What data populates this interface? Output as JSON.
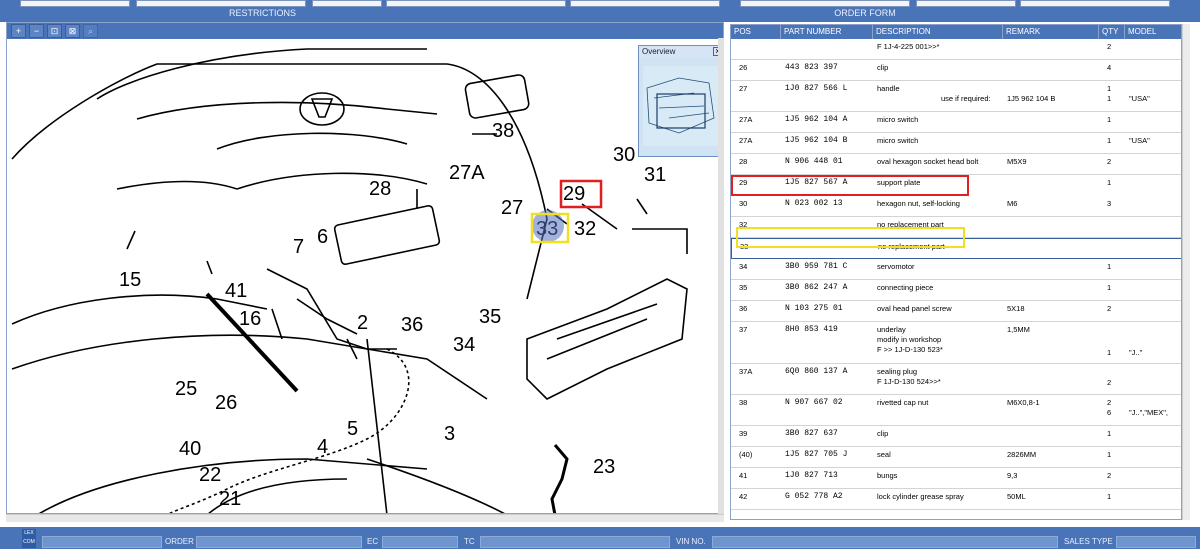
{
  "header": {
    "restrictions_label": "RESTRICTIONS",
    "order_form_label": "ORDER FORM"
  },
  "overview": {
    "title": "Overview",
    "close": "x"
  },
  "zoom_buttons": [
    "+",
    "−",
    "⊡",
    "⊠",
    "⌕"
  ],
  "callouts": [
    {
      "id": "c38",
      "text": "38"
    },
    {
      "id": "c28",
      "text": "28"
    },
    {
      "id": "c27a",
      "text": "27A"
    },
    {
      "id": "c27",
      "text": "27"
    },
    {
      "id": "c29",
      "text": "29"
    },
    {
      "id": "c30",
      "text": "30"
    },
    {
      "id": "c31",
      "text": "31"
    },
    {
      "id": "c33",
      "text": "33"
    },
    {
      "id": "c32",
      "text": "32"
    },
    {
      "id": "c15",
      "text": "15"
    },
    {
      "id": "c7",
      "text": "7"
    },
    {
      "id": "c6",
      "text": "6"
    },
    {
      "id": "c41",
      "text": "41"
    },
    {
      "id": "c16",
      "text": "16"
    },
    {
      "id": "c36",
      "text": "36"
    },
    {
      "id": "c35",
      "text": "35"
    },
    {
      "id": "c34",
      "text": "34"
    },
    {
      "id": "c2",
      "text": "2"
    },
    {
      "id": "c25",
      "text": "25"
    },
    {
      "id": "c26",
      "text": "26"
    },
    {
      "id": "c5",
      "text": "5"
    },
    {
      "id": "c4",
      "text": "4"
    },
    {
      "id": "c3",
      "text": "3"
    },
    {
      "id": "c40",
      "text": "40"
    },
    {
      "id": "c22",
      "text": "22"
    },
    {
      "id": "c21",
      "text": "21"
    },
    {
      "id": "c23",
      "text": "23"
    }
  ],
  "table": {
    "columns": [
      "POS",
      "PART NUMBER",
      "DESCRIPTION",
      "REMARK",
      "QTY",
      "MODEL"
    ],
    "rows": [
      {
        "pos": "",
        "part": "",
        "desc": "F 1J-4-225 001>>*",
        "remark": "",
        "qty": "2",
        "model": ""
      },
      {
        "pos": "26",
        "part": "443 823 397",
        "desc": "clip",
        "remark": "",
        "qty": "4",
        "model": ""
      },
      {
        "pos": "27",
        "part": "1J0 827 566 L",
        "desc": "handle",
        "remark": "",
        "qty": "1",
        "model": "",
        "sub": "use if required:",
        "sub_remark": "1J5 962 104 B",
        "sub_qty": "1",
        "sub_model": "\"USA\""
      },
      {
        "pos": "27A",
        "part": "1J5 962 104 A",
        "desc": "micro switch",
        "remark": "",
        "qty": "1",
        "model": ""
      },
      {
        "pos": "27A",
        "part": "1J5 962 104 B",
        "desc": "micro switch",
        "remark": "",
        "qty": "1",
        "model": "\"USA\""
      },
      {
        "pos": "28",
        "part": "N   906 448 01",
        "desc": "oval hexagon socket head bolt",
        "remark": "M5X9",
        "qty": "2",
        "model": ""
      },
      {
        "pos": "29",
        "part": "1J5 827 567 A",
        "desc": "support plate",
        "remark": "",
        "qty": "1",
        "model": ""
      },
      {
        "pos": "30",
        "part": "N   023 002 13",
        "desc": "hexagon nut, self-locking",
        "remark": "M6",
        "qty": "3",
        "model": ""
      },
      {
        "pos": "32",
        "part": "",
        "desc": "no replacement part",
        "remark": "",
        "qty": "",
        "model": ""
      },
      {
        "pos": "33",
        "part": "",
        "desc": "no replacement part",
        "remark": "",
        "qty": "",
        "model": ""
      },
      {
        "pos": "34",
        "part": "3B0 959 781 C",
        "desc": "servomotor",
        "remark": "",
        "qty": "1",
        "model": ""
      },
      {
        "pos": "35",
        "part": "3B0 862 247 A",
        "desc": "connecting piece",
        "remark": "",
        "qty": "1",
        "model": ""
      },
      {
        "pos": "36",
        "part": "N   103 275 01",
        "desc": "oval head panel screw",
        "remark": "5X18",
        "qty": "2",
        "model": ""
      },
      {
        "pos": "37",
        "part": "8H0 853 419",
        "desc": "underlay",
        "remark": "1,5MM",
        "qty": "1",
        "model": "\"J..\"",
        "sub1": "modify in workshop",
        "sub2": "F          >> 1J-D-130 523*"
      },
      {
        "pos": "37A",
        "part": "6Q0 860 137 A",
        "desc": "sealing plug",
        "remark": "",
        "qty": "2",
        "model": "",
        "sub1": "F 1J-D-130 524>>*"
      },
      {
        "pos": "38",
        "part": "N   907 667 02",
        "desc": "rivetted cap nut",
        "remark": "M6X0,8-1",
        "qty": "2",
        "model": "",
        "qty2": "6",
        "model2": "\"J..\",\"MEX\","
      },
      {
        "pos": "39",
        "part": "3B0 827 637",
        "desc": "clip",
        "remark": "",
        "qty": "1",
        "model": ""
      },
      {
        "pos": "(40)",
        "part": "1J5 827 705 J",
        "desc": "seal",
        "remark": "2826MM",
        "qty": "1",
        "model": ""
      },
      {
        "pos": "41",
        "part": "1J0 827 713",
        "desc": "bungs",
        "remark": "9,3",
        "qty": "2",
        "model": ""
      },
      {
        "pos": "42",
        "part": "G   052 778 A2",
        "desc": "lock cylinder grease spray",
        "remark": "50ML",
        "qty": "1",
        "model": ""
      }
    ]
  },
  "footer": {
    "logo": "LEX COM",
    "order": "ORDER",
    "ec": "EC",
    "tc": "TC",
    "vin": "VIN NO.",
    "sales_type": "SALES TYPE"
  },
  "colors": {
    "header": "#4a74b8",
    "highlight_red": "#e02020",
    "highlight_yellow": "#f0e020"
  }
}
